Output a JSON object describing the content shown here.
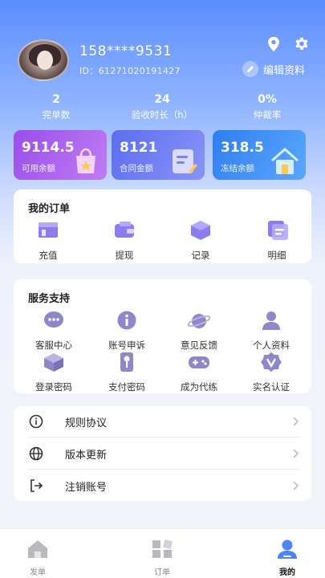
{
  "profile": {
    "phone": "158****9531",
    "uid": "ID：61271020191427",
    "edit_label": "编辑资料"
  },
  "stats": [
    {
      "value": "2",
      "label": "完单数"
    },
    {
      "value": "24",
      "label": "验收时长（h）"
    },
    {
      "value": "0%",
      "label": "仲裁率"
    }
  ],
  "balances": [
    {
      "amount": "9114.5",
      "label": "可用余额"
    },
    {
      "amount": "8121",
      "label": "合同金额"
    },
    {
      "amount": "318.5",
      "label": "冻结余额"
    }
  ],
  "orders": {
    "title": "我的订单",
    "items": [
      {
        "label": "充值",
        "icon": "wallet-card-icon"
      },
      {
        "label": "提现",
        "icon": "purse-icon"
      },
      {
        "label": "记录",
        "icon": "cube-icon"
      },
      {
        "label": "明细",
        "icon": "document-icon"
      }
    ]
  },
  "service": {
    "title": "服务支持",
    "items": [
      {
        "label": "客服中心",
        "icon": "chat-icon"
      },
      {
        "label": "账号申诉",
        "icon": "info-icon"
      },
      {
        "label": "意见反馈",
        "icon": "planet-icon"
      },
      {
        "label": "个人资料",
        "icon": "person-icon"
      },
      {
        "label": "登录密码",
        "icon": "box-icon"
      },
      {
        "label": "支付密码",
        "icon": "key-icon"
      },
      {
        "label": "成为代练",
        "icon": "gamepad-icon"
      },
      {
        "label": "实名认证",
        "icon": "badge-v-icon"
      }
    ]
  },
  "menu": [
    {
      "label": "规则协议",
      "icon": "info-circle-icon"
    },
    {
      "label": "版本更新",
      "icon": "globe-icon"
    },
    {
      "label": "注销账号",
      "icon": "logout-icon"
    }
  ],
  "tabs": [
    {
      "label": "发单",
      "icon": "home-icon"
    },
    {
      "label": "订单",
      "icon": "grid-icon"
    },
    {
      "label": "我的",
      "icon": "user-icon"
    }
  ],
  "colors": {
    "accent": "#5b8dff",
    "icon_purple": "#8b7cf0"
  }
}
